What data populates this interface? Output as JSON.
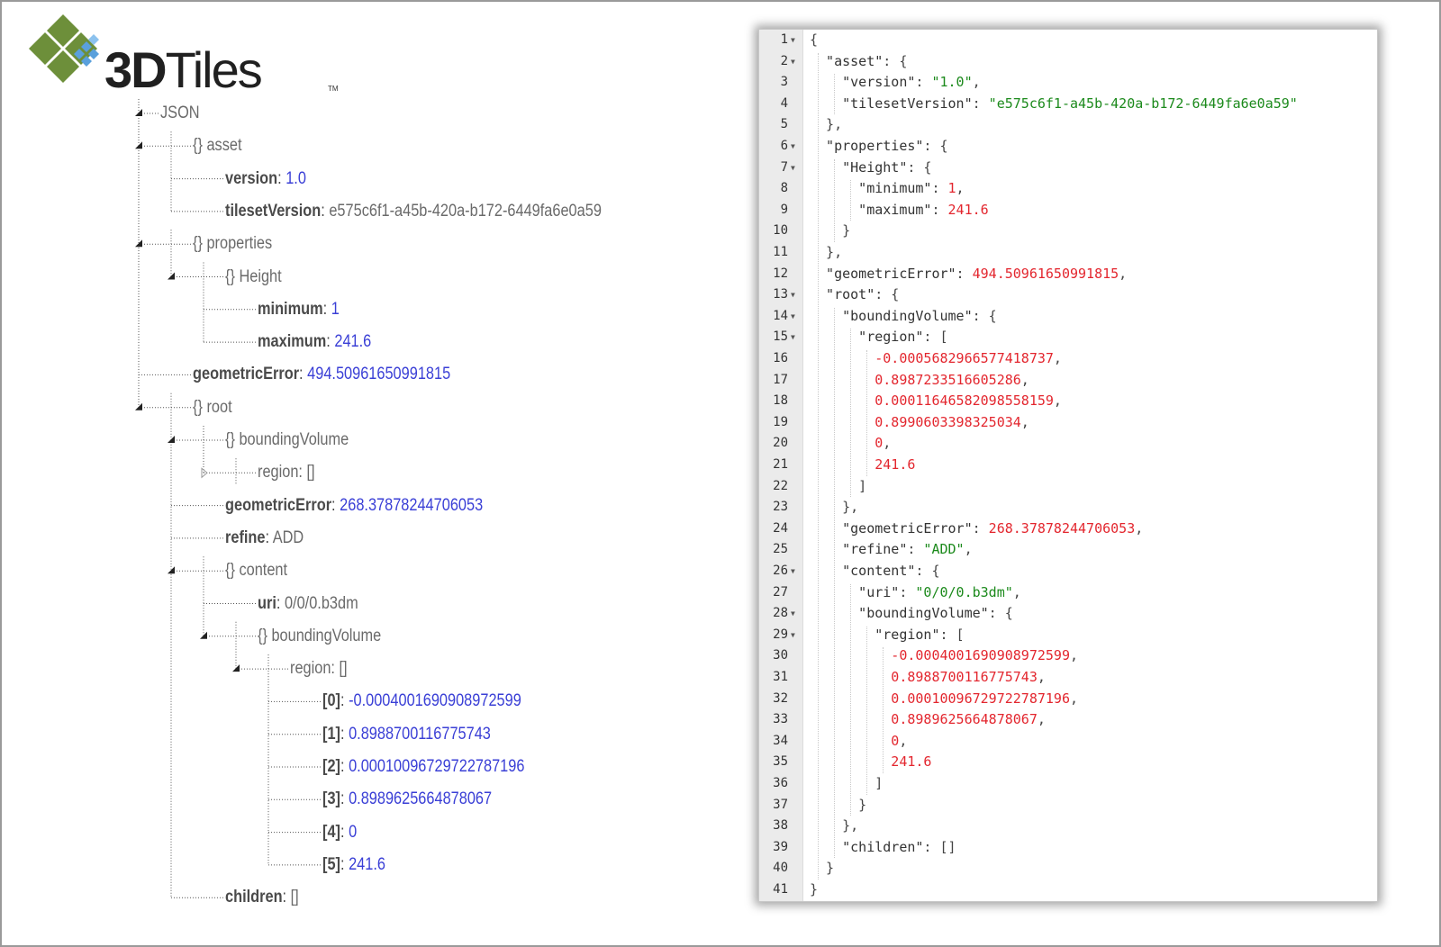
{
  "logo": {
    "text_bold": "3D",
    "text_light": "Tiles",
    "tm": "TM"
  },
  "colors": {
    "tree_value": "#3a3fd6",
    "code_string": "#1c8a1c",
    "code_number": "#e3262e"
  },
  "tree": [
    {
      "depth": 0,
      "type": "node",
      "text": "JSON",
      "expanded": true
    },
    {
      "depth": 1,
      "type": "node",
      "text": "{} asset",
      "expanded": true
    },
    {
      "depth": 2,
      "type": "leaf",
      "key": "version",
      "value": "1.0",
      "vtype": "num"
    },
    {
      "depth": 2,
      "type": "leaf",
      "key": "tilesetVersion",
      "value": "e575c6f1-a45b-420a-b172-6449fa6e0a59",
      "vtype": "str"
    },
    {
      "depth": 1,
      "type": "node",
      "text": "{} properties",
      "expanded": true
    },
    {
      "depth": 2,
      "type": "node",
      "text": "{} Height",
      "expanded": true
    },
    {
      "depth": 3,
      "type": "leaf",
      "key": "minimum",
      "value": "1",
      "vtype": "num"
    },
    {
      "depth": 3,
      "type": "leaf",
      "key": "maximum",
      "value": "241.6",
      "vtype": "num"
    },
    {
      "depth": 1,
      "type": "leaf",
      "key": "geometricError",
      "value": "494.50961650991815",
      "vtype": "num"
    },
    {
      "depth": 1,
      "type": "node",
      "text": "{} root",
      "expanded": true
    },
    {
      "depth": 2,
      "type": "node",
      "text": "{} boundingVolume",
      "expanded": true
    },
    {
      "depth": 3,
      "type": "node",
      "text": "region: []",
      "expanded": false
    },
    {
      "depth": 2,
      "type": "leaf",
      "key": "geometricError",
      "value": "268.37878244706053",
      "vtype": "num"
    },
    {
      "depth": 2,
      "type": "leaf",
      "key": "refine",
      "value": "ADD",
      "vtype": "str"
    },
    {
      "depth": 2,
      "type": "node",
      "text": "{} content",
      "expanded": true
    },
    {
      "depth": 3,
      "type": "leaf",
      "key": "uri",
      "value": "0/0/0.b3dm",
      "vtype": "str"
    },
    {
      "depth": 3,
      "type": "node",
      "text": "{} boundingVolume",
      "expanded": true
    },
    {
      "depth": 4,
      "type": "node",
      "text": "region: []",
      "expanded": true
    },
    {
      "depth": 5,
      "type": "leaf",
      "key": "[0]",
      "value": "-0.0004001690908972599",
      "vtype": "num"
    },
    {
      "depth": 5,
      "type": "leaf",
      "key": "[1]",
      "value": "0.8988700116775743",
      "vtype": "num"
    },
    {
      "depth": 5,
      "type": "leaf",
      "key": "[2]",
      "value": "0.00010096729722787196",
      "vtype": "num"
    },
    {
      "depth": 5,
      "type": "leaf",
      "key": "[3]",
      "value": "0.8989625664878067",
      "vtype": "num"
    },
    {
      "depth": 5,
      "type": "leaf",
      "key": "[4]",
      "value": "0",
      "vtype": "num"
    },
    {
      "depth": 5,
      "type": "leaf",
      "key": "[5]",
      "value": "241.6",
      "vtype": "num"
    },
    {
      "depth": 2,
      "type": "leaf",
      "key": "children",
      "value": "[]",
      "vtype": "plain"
    }
  ],
  "code": [
    {
      "indent": 0,
      "fold": true,
      "tokens": [
        [
          "p",
          "{"
        ]
      ]
    },
    {
      "indent": 1,
      "fold": true,
      "tokens": [
        [
          "k",
          "\"asset\""
        ],
        [
          "p",
          ": {"
        ]
      ]
    },
    {
      "indent": 2,
      "fold": false,
      "tokens": [
        [
          "k",
          "\"version\""
        ],
        [
          "p",
          ": "
        ],
        [
          "s",
          "\"1.0\""
        ],
        [
          "p",
          ","
        ]
      ]
    },
    {
      "indent": 2,
      "fold": false,
      "tokens": [
        [
          "k",
          "\"tilesetVersion\""
        ],
        [
          "p",
          ": "
        ],
        [
          "s",
          "\"e575c6f1-a45b-420a-b172-6449fa6e0a59\""
        ]
      ]
    },
    {
      "indent": 1,
      "fold": false,
      "tokens": [
        [
          "p",
          "},"
        ]
      ]
    },
    {
      "indent": 1,
      "fold": true,
      "tokens": [
        [
          "k",
          "\"properties\""
        ],
        [
          "p",
          ": {"
        ]
      ]
    },
    {
      "indent": 2,
      "fold": true,
      "tokens": [
        [
          "k",
          "\"Height\""
        ],
        [
          "p",
          ": {"
        ]
      ]
    },
    {
      "indent": 3,
      "fold": false,
      "tokens": [
        [
          "k",
          "\"minimum\""
        ],
        [
          "p",
          ": "
        ],
        [
          "n",
          "1"
        ],
        [
          "p",
          ","
        ]
      ]
    },
    {
      "indent": 3,
      "fold": false,
      "tokens": [
        [
          "k",
          "\"maximum\""
        ],
        [
          "p",
          ": "
        ],
        [
          "n",
          "241.6"
        ]
      ]
    },
    {
      "indent": 2,
      "fold": false,
      "tokens": [
        [
          "p",
          "}"
        ]
      ]
    },
    {
      "indent": 1,
      "fold": false,
      "tokens": [
        [
          "p",
          "},"
        ]
      ]
    },
    {
      "indent": 1,
      "fold": false,
      "tokens": [
        [
          "k",
          "\"geometricError\""
        ],
        [
          "p",
          ": "
        ],
        [
          "n",
          "494.50961650991815"
        ],
        [
          "p",
          ","
        ]
      ]
    },
    {
      "indent": 1,
      "fold": true,
      "tokens": [
        [
          "k",
          "\"root\""
        ],
        [
          "p",
          ": {"
        ]
      ]
    },
    {
      "indent": 2,
      "fold": true,
      "tokens": [
        [
          "k",
          "\"boundingVolume\""
        ],
        [
          "p",
          ": {"
        ]
      ]
    },
    {
      "indent": 3,
      "fold": true,
      "tokens": [
        [
          "k",
          "\"region\""
        ],
        [
          "p",
          ": ["
        ]
      ]
    },
    {
      "indent": 4,
      "fold": false,
      "tokens": [
        [
          "n",
          "-0.0005682966577418737"
        ],
        [
          "p",
          ","
        ]
      ]
    },
    {
      "indent": 4,
      "fold": false,
      "tokens": [
        [
          "n",
          "0.8987233516605286"
        ],
        [
          "p",
          ","
        ]
      ]
    },
    {
      "indent": 4,
      "fold": false,
      "tokens": [
        [
          "n",
          "0.00011646582098558159"
        ],
        [
          "p",
          ","
        ]
      ]
    },
    {
      "indent": 4,
      "fold": false,
      "tokens": [
        [
          "n",
          "0.8990603398325034"
        ],
        [
          "p",
          ","
        ]
      ]
    },
    {
      "indent": 4,
      "fold": false,
      "tokens": [
        [
          "n",
          "0"
        ],
        [
          "p",
          ","
        ]
      ]
    },
    {
      "indent": 4,
      "fold": false,
      "tokens": [
        [
          "n",
          "241.6"
        ]
      ]
    },
    {
      "indent": 3,
      "fold": false,
      "tokens": [
        [
          "p",
          "]"
        ]
      ]
    },
    {
      "indent": 2,
      "fold": false,
      "tokens": [
        [
          "p",
          "},"
        ]
      ]
    },
    {
      "indent": 2,
      "fold": false,
      "tokens": [
        [
          "k",
          "\"geometricError\""
        ],
        [
          "p",
          ": "
        ],
        [
          "n",
          "268.37878244706053"
        ],
        [
          "p",
          ","
        ]
      ]
    },
    {
      "indent": 2,
      "fold": false,
      "tokens": [
        [
          "k",
          "\"refine\""
        ],
        [
          "p",
          ": "
        ],
        [
          "s",
          "\"ADD\""
        ],
        [
          "p",
          ","
        ]
      ]
    },
    {
      "indent": 2,
      "fold": true,
      "tokens": [
        [
          "k",
          "\"content\""
        ],
        [
          "p",
          ": {"
        ]
      ]
    },
    {
      "indent": 3,
      "fold": false,
      "tokens": [
        [
          "k",
          "\"uri\""
        ],
        [
          "p",
          ": "
        ],
        [
          "s",
          "\"0/0/0.b3dm\""
        ],
        [
          "p",
          ","
        ]
      ]
    },
    {
      "indent": 3,
      "fold": true,
      "tokens": [
        [
          "k",
          "\"boundingVolume\""
        ],
        [
          "p",
          ": {"
        ]
      ]
    },
    {
      "indent": 4,
      "fold": true,
      "tokens": [
        [
          "k",
          "\"region\""
        ],
        [
          "p",
          ": ["
        ]
      ]
    },
    {
      "indent": 5,
      "fold": false,
      "tokens": [
        [
          "n",
          "-0.0004001690908972599"
        ],
        [
          "p",
          ","
        ]
      ]
    },
    {
      "indent": 5,
      "fold": false,
      "tokens": [
        [
          "n",
          "0.8988700116775743"
        ],
        [
          "p",
          ","
        ]
      ]
    },
    {
      "indent": 5,
      "fold": false,
      "tokens": [
        [
          "n",
          "0.00010096729722787196"
        ],
        [
          "p",
          ","
        ]
      ]
    },
    {
      "indent": 5,
      "fold": false,
      "tokens": [
        [
          "n",
          "0.8989625664878067"
        ],
        [
          "p",
          ","
        ]
      ]
    },
    {
      "indent": 5,
      "fold": false,
      "tokens": [
        [
          "n",
          "0"
        ],
        [
          "p",
          ","
        ]
      ]
    },
    {
      "indent": 5,
      "fold": false,
      "tokens": [
        [
          "n",
          "241.6"
        ]
      ]
    },
    {
      "indent": 4,
      "fold": false,
      "tokens": [
        [
          "p",
          "]"
        ]
      ]
    },
    {
      "indent": 3,
      "fold": false,
      "tokens": [
        [
          "p",
          "}"
        ]
      ]
    },
    {
      "indent": 2,
      "fold": false,
      "tokens": [
        [
          "p",
          "},"
        ]
      ]
    },
    {
      "indent": 2,
      "fold": false,
      "tokens": [
        [
          "k",
          "\"children\""
        ],
        [
          "p",
          ": []"
        ]
      ]
    },
    {
      "indent": 1,
      "fold": false,
      "tokens": [
        [
          "p",
          "}"
        ]
      ]
    },
    {
      "indent": 0,
      "fold": false,
      "tokens": [
        [
          "p",
          "}"
        ]
      ]
    }
  ]
}
